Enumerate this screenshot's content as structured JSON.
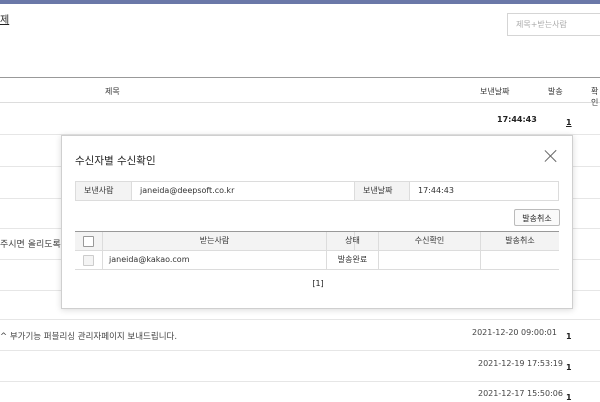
{
  "top": {
    "fragment": "제",
    "search_placeholder": "제목+받는사람"
  },
  "table_header": {
    "title": "제목",
    "date": "보낸날짜",
    "send": "발송",
    "confirm": "확인"
  },
  "rows": [
    {
      "subject": "",
      "date": "17:44:43",
      "count": "1"
    },
    {
      "subject": "",
      "date": "",
      "count": ""
    },
    {
      "subject": "",
      "date": "",
      "count": ""
    },
    {
      "subject": "주시면 올리도록",
      "date": "",
      "count": ""
    },
    {
      "subject": "",
      "date": "",
      "count": ""
    },
    {
      "subject": "^ 부가기능 퍼블리싱 관리자페이지 보내드립니다.",
      "date": "2021-12-20 09:00:01",
      "count": "1"
    },
    {
      "subject": "",
      "date": "2021-12-19 17:53:19",
      "count": "1"
    },
    {
      "subject": "",
      "date": "2021-12-17 15:50:06",
      "count": "1"
    }
  ],
  "modal": {
    "title": "수신자별 수신확인",
    "sender_label": "보낸사람",
    "sender_value": "janeida@deepsoft.co.kr",
    "date_label": "보낸날짜",
    "date_value": "17:44:43",
    "cancel_button": "발송취소",
    "columns": [
      "받는사람",
      "상태",
      "수신확인",
      "발송취소"
    ],
    "recipients": [
      {
        "email": "janeida@kakao.com",
        "status": "발송완료",
        "confirm": "",
        "cancel": ""
      }
    ],
    "pagination": "[1]"
  }
}
